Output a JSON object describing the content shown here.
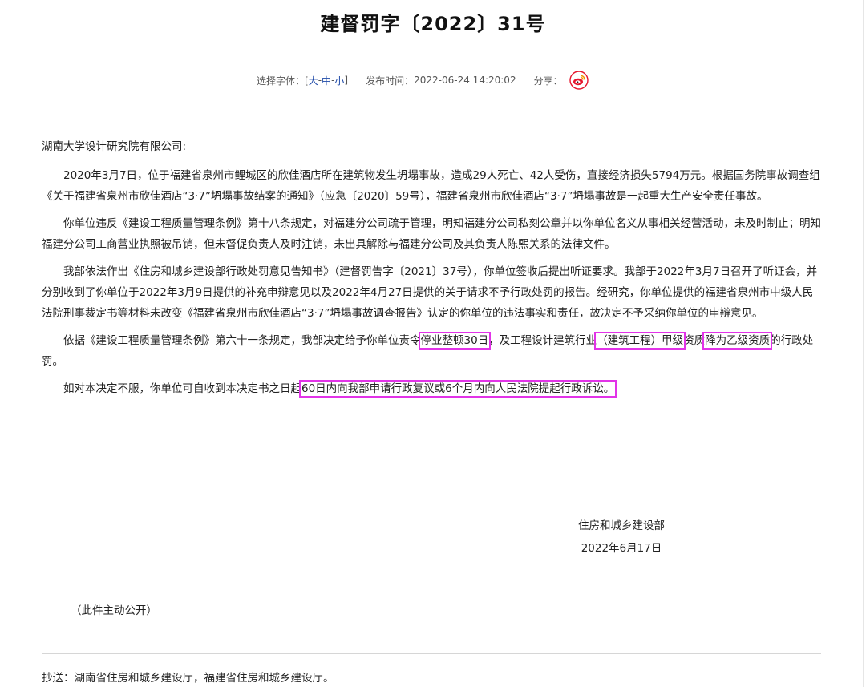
{
  "doc": {
    "title": "建督罚字〔2022〕31号"
  },
  "meta": {
    "font_label": "选择字体：[",
    "font_large": "大",
    "sep1": " - ",
    "font_medium": "中",
    "sep2": " - ",
    "font_small": "小",
    "font_close": "]",
    "publish_label": "发布时间：",
    "publish_time": "2022-06-24 14:20:02",
    "share_label": "分享：",
    "share_icon": "weibo-icon"
  },
  "body": {
    "salutation": "湖南大学设计研究院有限公司:",
    "p1": "2020年3月7日，位于福建省泉州市鲤城区的欣佳酒店所在建筑物发生坍塌事故，造成29人死亡、42人受伤，直接经济损失5794万元。根据国务院事故调查组《关于福建省泉州市欣佳酒店“3·7”坍塌事故结案的通知》（应急〔2020〕59号），福建省泉州市欣佳酒店“3·7”坍塌事故是一起重大生产安全责任事故。",
    "p2": "你单位违反《建设工程质量管理条例》第十八条规定，对福建分公司疏于管理，明知福建分公司私刻公章并以你单位名义从事相关经营活动，未及时制止；明知福建分公司工商营业执照被吊销，但未督促负责人及时注销，未出具解除与福建分公司及其负责人陈熙关系的法律文件。",
    "p3": "我部依法作出《住房和城乡建设部行政处罚意见告知书》（建督罚告字〔2021〕37号），你单位签收后提出听证要求。我部于2022年3月7日召开了听证会，并分别收到了你单位于2022年3月9日提供的补充申辩意见以及2022年4月27日提供的关于请求不予行政处罚的报告。经研究，你单位提供的福建省泉州市中级人民法院刑事裁定书等材料未改变《福建省泉州市欣佳酒店“3·7”坍塌事故调查报告》认定的你单位的违法事实和责任，故决定不予采纳你单位的申辩意见。",
    "p4": {
      "a": "依据《建设工程质量管理条例》第六十一条规定，我部决定给予你单位责令",
      "b": "停业整顿30日",
      "c": "，及工程设计建筑行业",
      "d": "（建筑工程）甲级",
      "e": "资质",
      "f": "降为乙级资质",
      "g": "的行政处罚。"
    },
    "p5": {
      "a": "如对本决定不服，你单位可自收到本决定书之日起",
      "b": "60日内向我部申请行政复议或6个月内向人民法院提起行政诉讼。"
    }
  },
  "signature": {
    "org": "住房和城乡建设部",
    "date": "2022年6月17日"
  },
  "note": "（此件主动公开）",
  "cc": "抄送：湖南省住房和城乡建设厅，福建省住房和城乡建设厅。",
  "colors": {
    "highlight": "#e233e8",
    "link": "#1f4aa8",
    "weibo": "#e6162d"
  }
}
